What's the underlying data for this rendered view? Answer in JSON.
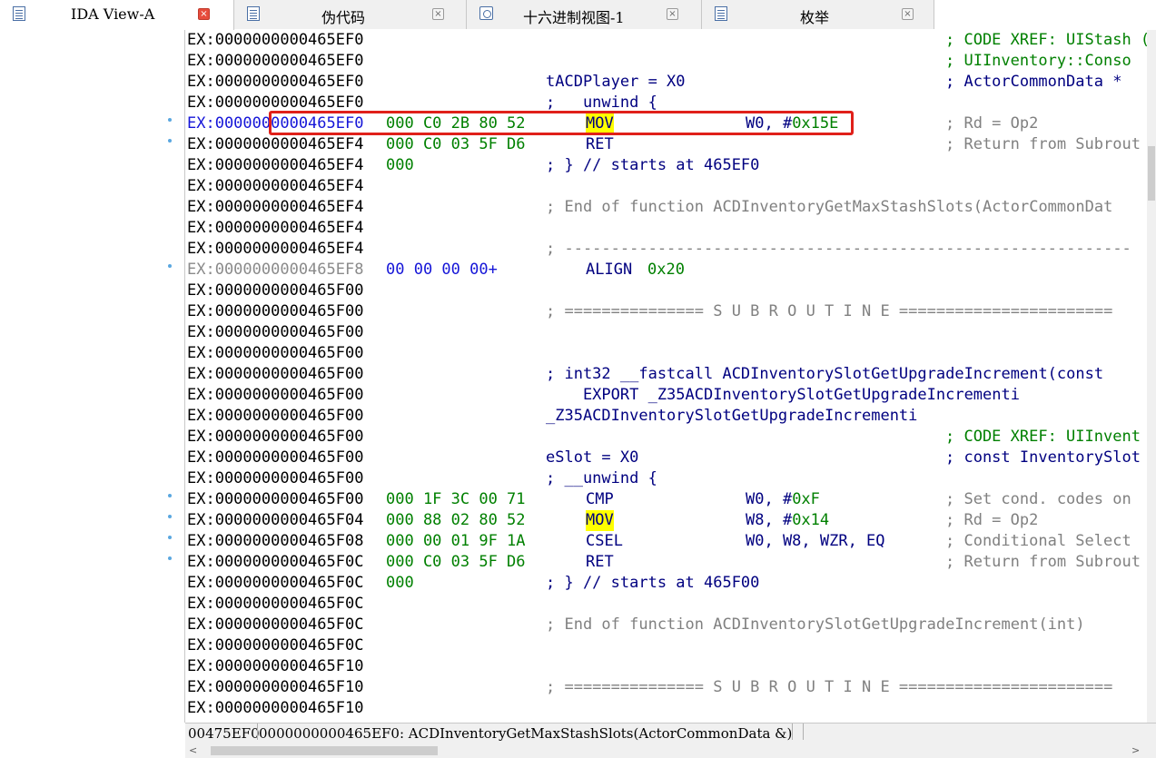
{
  "tabs": [
    {
      "label": "IDA View-A",
      "icon": "listing-icon",
      "active": true
    },
    {
      "label": "伪代码",
      "icon": "pseudocode-icon",
      "active": false
    },
    {
      "label": "十六进制视图-1",
      "icon": "hex-view-icon",
      "active": false
    },
    {
      "label": "枚举",
      "icon": "enum-icon",
      "active": false
    }
  ],
  "close_glyph": "×",
  "listing": [
    {
      "addr": "EX:0000000000465EF0",
      "xref": "; CODE XREF: UIStash ("
    },
    {
      "addr": "EX:0000000000465EF0",
      "xref": "; UIInventory::Conso"
    },
    {
      "addr": "EX:0000000000465EF0",
      "ins": "tACDPlayer = X0",
      "xref": "; ActorCommonData *"
    },
    {
      "addr": "EX:0000000000465EF0",
      "ins": ";   unwind {"
    },
    {
      "addr": "EX:0000000000465EF0",
      "bytes": "000 C0 2B 80 52",
      "mn": "MOV",
      "ops_a": "W0, #",
      "ops_n": "0x15E",
      "rcmt": "; Rd = Op2"
    },
    {
      "addr": "EX:0000000000465EF4",
      "bytes": "000 C0 03 5F D6",
      "mn": "RET",
      "rcmt": "; Return from Subrout"
    },
    {
      "addr": "EX:0000000000465EF4",
      "bytes": "000",
      "ins": "; } // starts at 465EF0"
    },
    {
      "addr": "EX:0000000000465EF4"
    },
    {
      "addr": "EX:0000000000465EF4",
      "cmt": "; End of function ACDInventoryGetMaxStashSlots(ActorCommonDat"
    },
    {
      "addr": "EX:0000000000465EF4"
    },
    {
      "addr": "EX:0000000000465EF4",
      "cmt": "; -------------------------------------------------------------"
    },
    {
      "addr": "EX:0000000000465EF8",
      "bytes": "00 00 00 00+",
      "mn": "ALIGN",
      "ops_n": "0x20"
    },
    {
      "addr": "EX:0000000000465F00"
    },
    {
      "addr": "EX:0000000000465F00",
      "cmt": "; =============== S U B R O U T I N E ======================="
    },
    {
      "addr": "EX:0000000000465F00"
    },
    {
      "addr": "EX:0000000000465F00"
    },
    {
      "addr": "EX:0000000000465F00",
      "ins": "; int32 __fastcall ACDInventorySlotGetUpgradeIncrement(const"
    },
    {
      "addr": "EX:0000000000465F00",
      "ins": "    EXPORT _Z35ACDInventorySlotGetUpgradeIncrementi"
    },
    {
      "addr": "EX:0000000000465F00",
      "ins": "_Z35ACDInventorySlotGetUpgradeIncrementi"
    },
    {
      "addr": "EX:0000000000465F00",
      "xref": "; CODE XREF: UIInvent"
    },
    {
      "addr": "EX:0000000000465F00",
      "ins": "eSlot = X0",
      "xref": "; const InventorySlot"
    },
    {
      "addr": "EX:0000000000465F00",
      "ins": "; __unwind {"
    },
    {
      "addr": "EX:0000000000465F00",
      "bytes": "000 1F 3C 00 71",
      "mn": "CMP",
      "ops_a": "W0, #",
      "ops_n": "0xF",
      "rcmt": "; Set cond. codes on"
    },
    {
      "addr": "EX:0000000000465F04",
      "bytes": "000 88 02 80 52",
      "mn": "MOV",
      "ops_a": "W8, #",
      "ops_n": "0x14",
      "rcmt": "; Rd = Op2"
    },
    {
      "addr": "EX:0000000000465F08",
      "bytes": "000 00 01 9F 1A",
      "mn": "CSEL",
      "ops_a": "W0, W8, WZR, EQ",
      "rcmt": "; Conditional Select"
    },
    {
      "addr": "EX:0000000000465F0C",
      "bytes": "000 C0 03 5F D6",
      "mn": "RET",
      "rcmt": "; Return from Subrout"
    },
    {
      "addr": "EX:0000000000465F0C",
      "bytes": "000",
      "ins": "; } // starts at 465F00"
    },
    {
      "addr": "EX:0000000000465F0C"
    },
    {
      "addr": "EX:0000000000465F0C",
      "cmt": "; End of function ACDInventorySlotGetUpgradeIncrement(int)"
    },
    {
      "addr": "EX:0000000000465F0C"
    },
    {
      "addr": "EX:0000000000465F10"
    },
    {
      "addr": "EX:0000000000465F10",
      "cmt": "; =============== S U B R O U T I N E ======================="
    },
    {
      "addr": "EX:0000000000465F10"
    }
  ],
  "status": {
    "offset": "00475EF0",
    "location": "0000000000465EF0: ACDInventoryGetMaxStashSlots(ActorCommonData &)"
  },
  "scroll": {
    "left_arrow": "<",
    "right_arrow": ">"
  },
  "colors": {
    "highlight_box": "#e0201a",
    "mnemonic_highlight": "#ffff00",
    "number": "#008000",
    "instruction": "#000080"
  }
}
